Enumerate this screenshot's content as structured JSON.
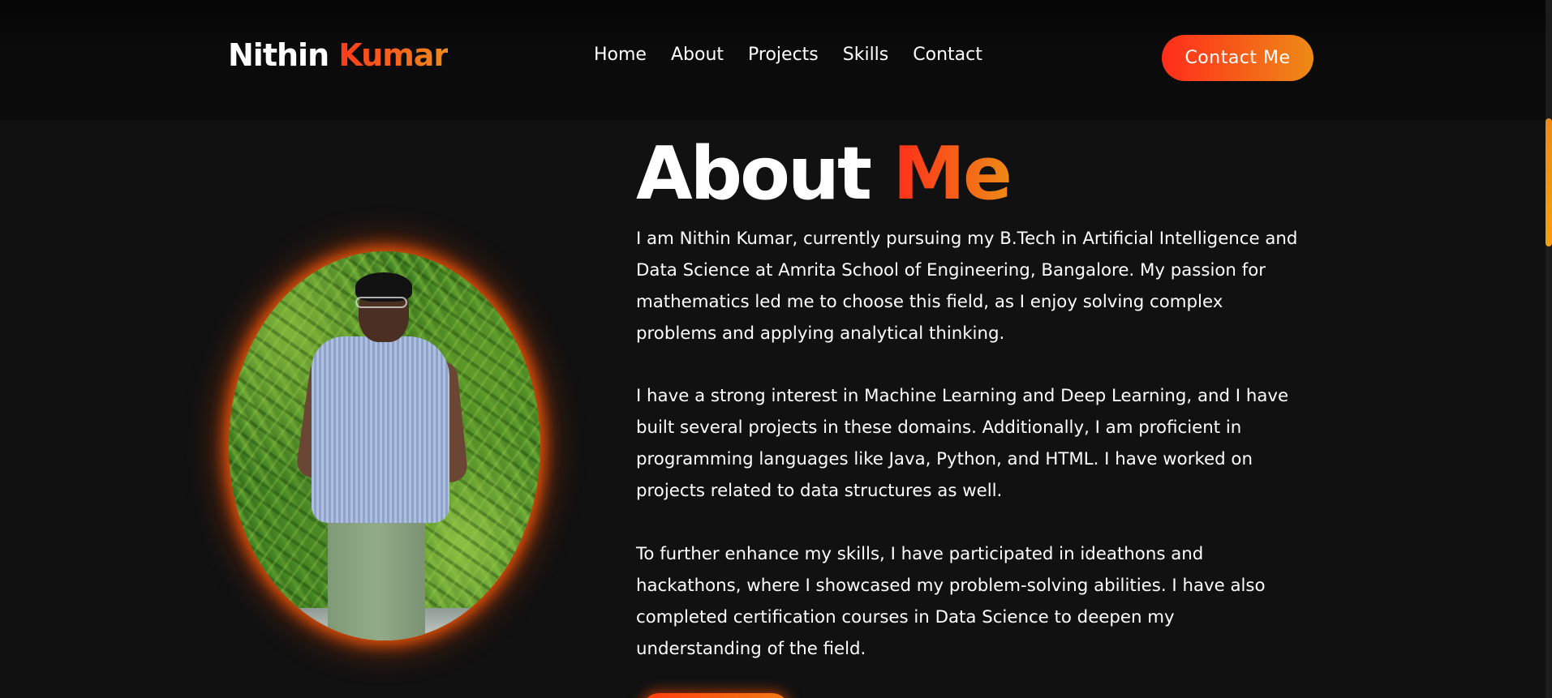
{
  "header": {
    "logo_first": "Nithin",
    "logo_second": "Kumar",
    "nav": [
      {
        "label": "Home"
      },
      {
        "label": "About"
      },
      {
        "label": "Projects"
      },
      {
        "label": "Skills"
      },
      {
        "label": "Contact"
      }
    ],
    "cta_label": "Contact Me"
  },
  "about": {
    "title_first": "About",
    "title_second": "Me",
    "paragraphs": [
      "I am Nithin Kumar, currently pursuing my B.Tech in Artificial Intelligence and Data Science at Amrita School of Engineering, Bangalore. My passion for mathematics led me to choose this field, as I enjoy solving complex problems and applying analytical thinking.",
      "I have a strong interest in Machine Learning and Deep Learning, and I have built several projects in these domains. Additionally, I am proficient in programming languages like Java, Python, and HTML. I have worked on projects related to data structures as well.",
      "To further enhance my skills, I have participated in ideathons and hackathons, where I showcased my problem-solving abilities. I have also completed certification courses in Data Science to deepen my understanding of the field."
    ]
  },
  "colors": {
    "background": "#111111",
    "header_background": "#0b0b0b",
    "accent_start": "#ff2d1a",
    "accent_end": "#ee8a16",
    "text": "#ffffff"
  }
}
